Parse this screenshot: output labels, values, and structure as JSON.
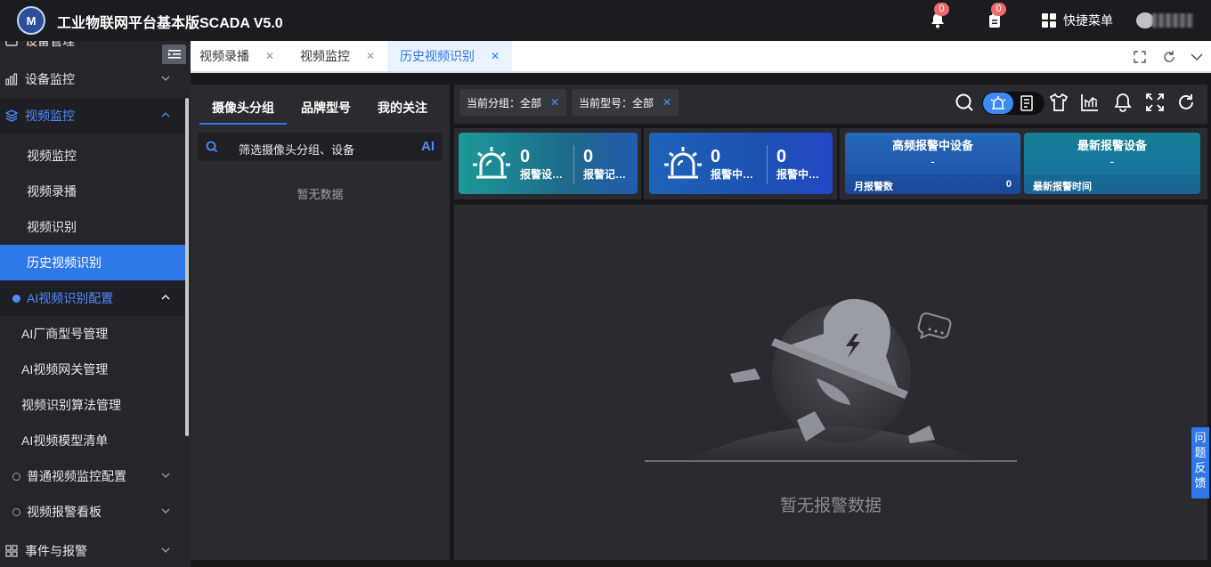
{
  "app": {
    "title": "工业物联网平台基本版SCADA V5.0",
    "logo_text": "M",
    "notifications_count": "0",
    "messages_count": "0",
    "quick_menu_label": "快捷菜单"
  },
  "sidebar": {
    "items": [
      {
        "label": "设备管理",
        "type": "top"
      },
      {
        "label": "设备监控",
        "type": "top"
      },
      {
        "label": "视频监控",
        "type": "open"
      },
      {
        "label": "视频监控",
        "type": "sub"
      },
      {
        "label": "视频录播",
        "type": "sub"
      },
      {
        "label": "视频识别",
        "type": "sub"
      },
      {
        "label": "历史视频识别",
        "type": "active"
      },
      {
        "label": "AI视频识别配置",
        "type": "open-dot"
      },
      {
        "label": "AI厂商型号管理",
        "type": "sub2"
      },
      {
        "label": "AI视频网关管理",
        "type": "sub2"
      },
      {
        "label": "视频识别算法管理",
        "type": "sub2"
      },
      {
        "label": "AI视频模型清单",
        "type": "sub2"
      },
      {
        "label": "普通视频监控配置",
        "type": "dot"
      },
      {
        "label": "视频报警看板",
        "type": "dot"
      },
      {
        "label": "事件与报警",
        "type": "top"
      }
    ]
  },
  "tabs": [
    {
      "label": "视频录播",
      "active": false
    },
    {
      "label": "视频监控",
      "active": false
    },
    {
      "label": "历史视频识别",
      "active": true
    }
  ],
  "left_panel": {
    "tabs": [
      "摄像头分组",
      "品牌型号",
      "我的关注"
    ],
    "search_placeholder": "筛选摄像头分组、设备",
    "ai_label": "AI",
    "empty_text": "暂无数据"
  },
  "filters": [
    {
      "label": "当前分组：全部"
    },
    {
      "label": "当前型号：全部"
    }
  ],
  "stats": {
    "card1": {
      "v1": "0",
      "l1": "报警设…",
      "v2": "0",
      "l2": "报警记…"
    },
    "card2": {
      "v1": "0",
      "l1": "报警中…",
      "v2": "0",
      "l2": "报警中…"
    },
    "card3": {
      "title": "高频报警中设备",
      "value": "-",
      "foot_label": "月报警数",
      "foot_value": "0"
    },
    "card4": {
      "title": "最新报警设备",
      "value": "-",
      "foot_label": "最新报警时间"
    }
  },
  "main": {
    "empty_text": "暂无报警数据"
  },
  "feedback_label": "问题反馈",
  "colors": {
    "accent": "#2e78e8",
    "bg": "#18181b",
    "panel": "#2a2b30",
    "teal": "#1a8c8e",
    "blue": "#1d5fb8"
  }
}
